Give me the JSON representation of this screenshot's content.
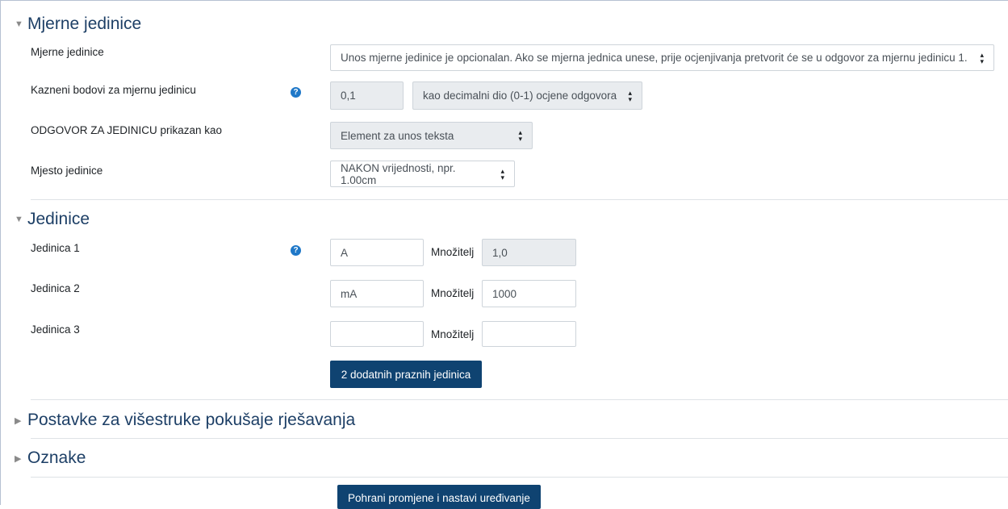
{
  "sections": {
    "units": {
      "title": "Mjerne jedinice",
      "expanded": true
    },
    "unit_list": {
      "title": "Jedinice",
      "expanded": true
    },
    "multitry": {
      "title": "Postavke za višestruke pokušaje rješavanja",
      "expanded": false
    },
    "tags": {
      "title": "Oznake",
      "expanded": false
    }
  },
  "units_fields": {
    "handling_label": "Mjerne jedinice",
    "handling_value": "Unos mjerne jedinice je opcionalan. Ako se mjerna jednica unese, prije ocjenjivanja pretvorit će se u odgovor za mjernu jedinicu 1.",
    "penalty_label": "Kazneni bodovi za mjernu jedinicu",
    "penalty_value": "0,1",
    "penalty_mode": "kao decimalni dio (0-1) ocjene odgovora",
    "display_label": "ODGOVOR ZA JEDINICU prikazan kao",
    "display_value": "Element za unos teksta",
    "position_label": "Mjesto jedinice",
    "position_value": "NAKON vrijednosti, npr. 1.00cm"
  },
  "unit_rows": [
    {
      "label": "Jedinica 1",
      "unit": "A",
      "multiplier_label": "Množitelj",
      "multiplier": "1,0"
    },
    {
      "label": "Jedinica 2",
      "unit": "mA",
      "multiplier_label": "Množitelj",
      "multiplier": "1000"
    },
    {
      "label": "Jedinica 3",
      "unit": "",
      "multiplier_label": "Množitelj",
      "multiplier": ""
    }
  ],
  "buttons": {
    "add_units": "2 dodatnih praznih jedinica",
    "save_continue": "Pohrani promjene i nastavi uređivanje"
  },
  "icons": {
    "help": "question-circle-icon",
    "expanded": "triangle-down-icon",
    "collapsed": "triangle-right-icon",
    "select": "select-caret-icon"
  },
  "colors": {
    "button": "#0f4371",
    "heading": "#1d3f66",
    "help": "#1f78c8",
    "disabled": "#e9ecef"
  }
}
